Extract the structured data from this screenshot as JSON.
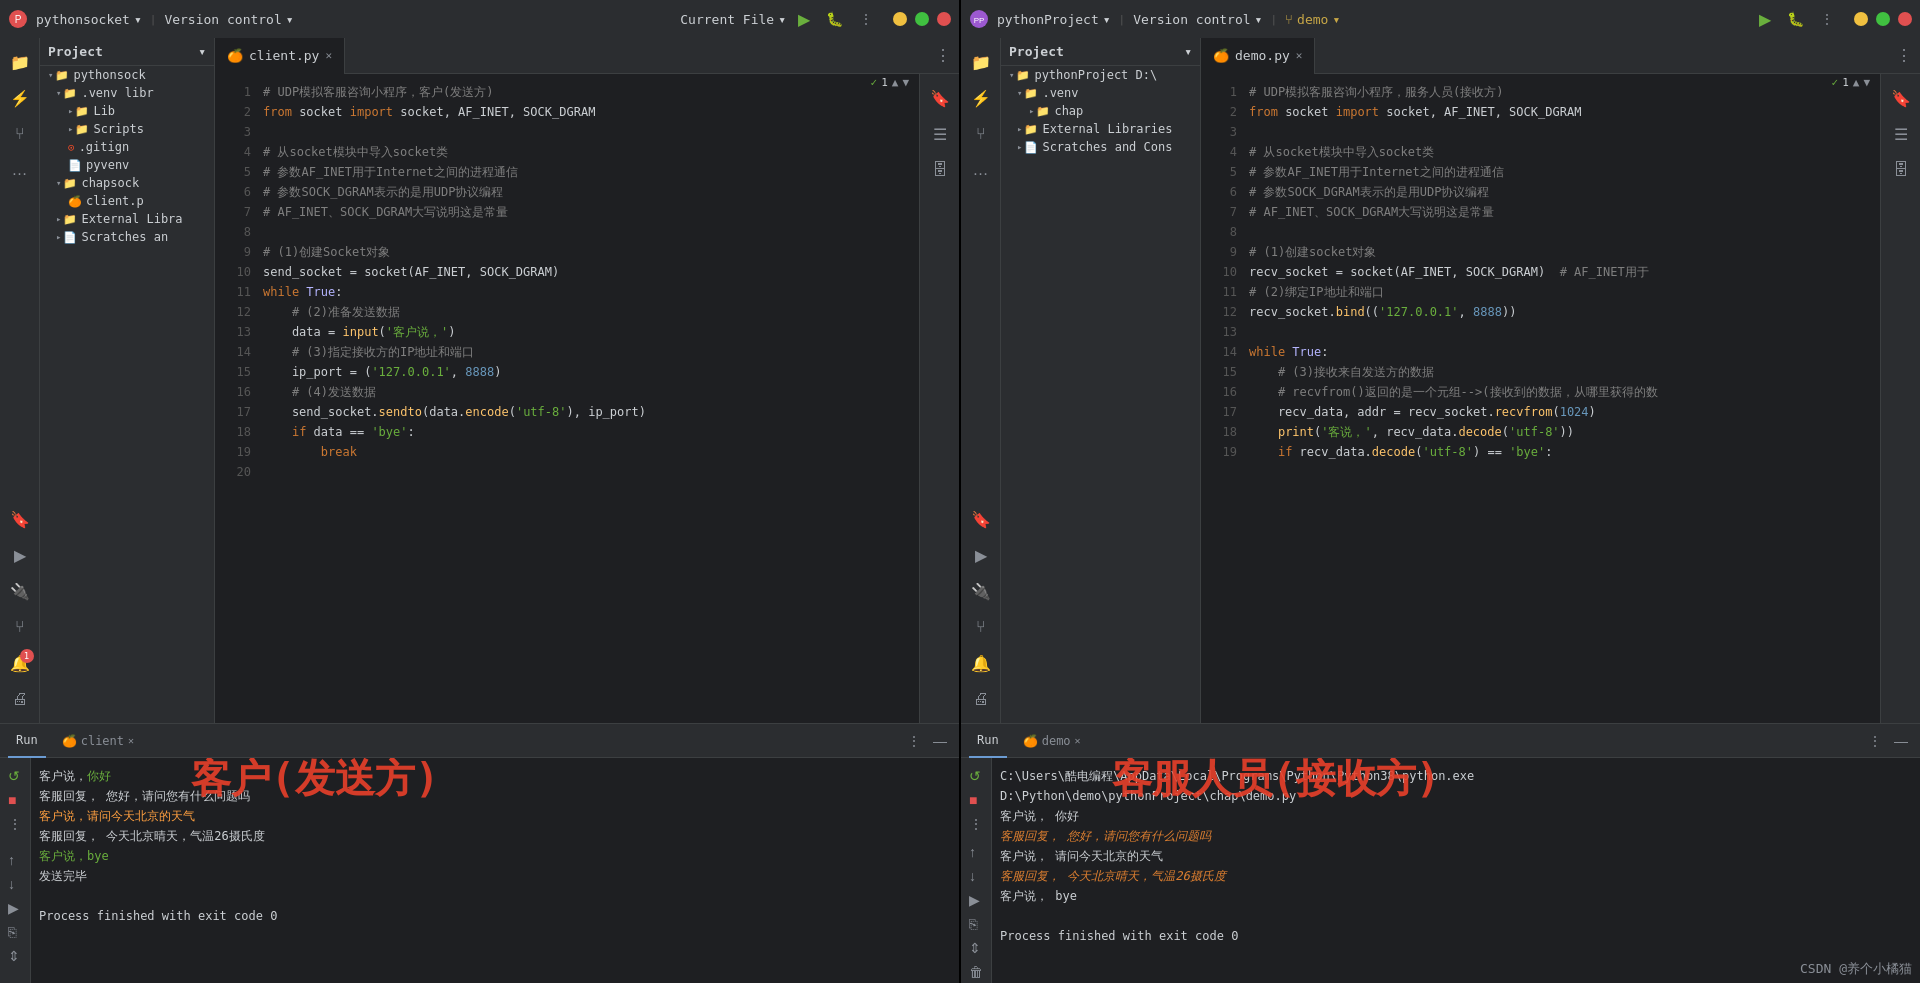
{
  "left": {
    "title_bar": {
      "logo": "🔴",
      "project_name": "pythonsocket",
      "vc_label": "Version control",
      "file_label": "Current File",
      "chevron": "▾"
    },
    "tabs": [
      {
        "label": "client.py",
        "active": true,
        "icon": "🍊"
      }
    ],
    "tree": {
      "header": "Project",
      "items": [
        {
          "indent": 0,
          "type": "folder",
          "label": "pythonsock",
          "expanded": true
        },
        {
          "indent": 1,
          "type": "folder",
          "label": ".venv  libr",
          "expanded": true
        },
        {
          "indent": 2,
          "type": "folder",
          "label": "Lib",
          "expanded": false
        },
        {
          "indent": 2,
          "type": "folder",
          "label": "Scripts",
          "expanded": false
        },
        {
          "indent": 2,
          "type": "file",
          "label": ".gitign",
          "icon": "git"
        },
        {
          "indent": 2,
          "type": "file",
          "label": "pyvenv",
          "icon": "file"
        },
        {
          "indent": 1,
          "type": "folder",
          "label": "chapsock",
          "expanded": true
        },
        {
          "indent": 2,
          "type": "file",
          "label": "client.p",
          "icon": "py"
        },
        {
          "indent": 1,
          "type": "folder",
          "label": "External Libra",
          "expanded": false
        },
        {
          "indent": 1,
          "type": "folder",
          "label": "Scratches an",
          "expanded": false
        }
      ]
    },
    "code": {
      "filename": "client.py",
      "lines": [
        "# UDP模拟客服咨询小程序，客户(发送方)",
        "from socket import socket, AF_INET, SOCK_DGRAM",
        "",
        "# 从socket模块中导入socket类",
        "# 参数AF_INET用于Internet之间的进程通信",
        "# 参数SOCK_DGRAM表示的是用UDP协议编程",
        "# AF_INET、SOCK_DGRAM大写说明这是常量",
        "",
        "# (1)创建Socket对象",
        "send_socket = socket(AF_INET, SOCK_DGRAM)",
        "while True:",
        "    # (2)准备发送数据",
        "    data = input('客户说，')",
        "    # (3)指定接收方的IP地址和端口",
        "    ip_port = ('127.0.0.1', 8888)",
        "    # (4)发送数据",
        "    send_socket.sendto(data.encode('utf-8'), ip_port)",
        "    if data == 'bye':",
        "        break",
        ""
      ]
    },
    "run": {
      "tab_label": "Run",
      "file_tab": "client",
      "output": [
        {
          "text": "客户说，你好",
          "color": "white"
        },
        {
          "text": "客服回复，  您好，请问您有什么问题吗",
          "color": "white"
        },
        {
          "text": "客户说，请问今天北京的天气",
          "color": "orange"
        },
        {
          "text": "客服回复，  今天北京晴天，气温26摄氏度",
          "color": "white"
        },
        {
          "text": "客户说，bye",
          "color": "green"
        },
        {
          "text": "发送完毕",
          "color": "white"
        },
        {
          "text": "",
          "color": "white"
        },
        {
          "text": "Process finished with exit code 0",
          "color": "white"
        }
      ]
    },
    "watermark": "客户(发送方)"
  },
  "right": {
    "title_bar": {
      "logo": "🟣",
      "project_name": "pythonProject",
      "vc_label": "Version control",
      "branch": "demo",
      "chevron": "▾"
    },
    "tabs": [
      {
        "label": "demo.py",
        "active": true,
        "icon": "🍊"
      }
    ],
    "tree": {
      "header": "Project",
      "items": [
        {
          "indent": 0,
          "type": "folder",
          "label": "pythonProject  D:\\",
          "expanded": true
        },
        {
          "indent": 1,
          "type": "folder",
          "label": ".venv",
          "expanded": true
        },
        {
          "indent": 2,
          "type": "folder",
          "label": "chap",
          "expanded": false
        },
        {
          "indent": 1,
          "type": "folder",
          "label": "External Libraries",
          "expanded": false
        },
        {
          "indent": 1,
          "type": "folder",
          "label": "Scratches and Cons",
          "expanded": false
        }
      ]
    },
    "code": {
      "filename": "demo.py",
      "lines": [
        "# UDP模拟客服咨询小程序，服务人员(接收方)",
        "from socket import socket, AF_INET, SOCK_DGRAM",
        "",
        "# 从socket模块中导入socket类",
        "# 参数AF_INET用于Internet之间的进程通信",
        "# 参数SOCK_DGRAM表示的是用UDP协议编程",
        "# AF_INET、SOCK_DGRAM大写说明这是常量",
        "",
        "# (1)创建socket对象",
        "recv_socket = socket(AF_INET, SOCK_DGRAM)  # AF_INET用于",
        "# (2)绑定IP地址和端口",
        "recv_socket.bind(('127.0.0.1', 8888))",
        "",
        "while True:",
        "    # (3)接收来自发送方的数据",
        "    # recvfrom()返回的是一个元组-->(接收到的数据，从哪里获得的数",
        "    recv_data, addr = recv_socket.recvfrom(1024)",
        "    print('客说，', recv_data.decode('utf-8'))",
        "    if recv_data.decode('utf-8') == 'bye':"
      ]
    },
    "run": {
      "tab_label": "Run",
      "file_tab": "demo",
      "path_line1": "C:\\Users\\酷电编程\\AppData\\Local\\Programs\\Python\\Python38\\python.exe",
      "path_line2": " D:\\Python\\demo\\pythonProject\\chap\\demo.py",
      "output": [
        {
          "text": "客户说，  你好",
          "color": "white"
        },
        {
          "text": "客服回复，  您好，请问您有什么问题吗",
          "color": "italic-green"
        },
        {
          "text": "客户说，  请问今天北京的天气",
          "color": "white"
        },
        {
          "text": "客服回复，  今天北京晴天，气温26摄氏度",
          "color": "italic-green"
        },
        {
          "text": "客户说，  bye",
          "color": "white"
        },
        {
          "text": "",
          "color": "white"
        },
        {
          "text": "Process finished with exit code 0",
          "color": "white"
        }
      ]
    },
    "watermark": "客服人员(接收方)",
    "footer": "CSDN @养个小橘猫"
  }
}
